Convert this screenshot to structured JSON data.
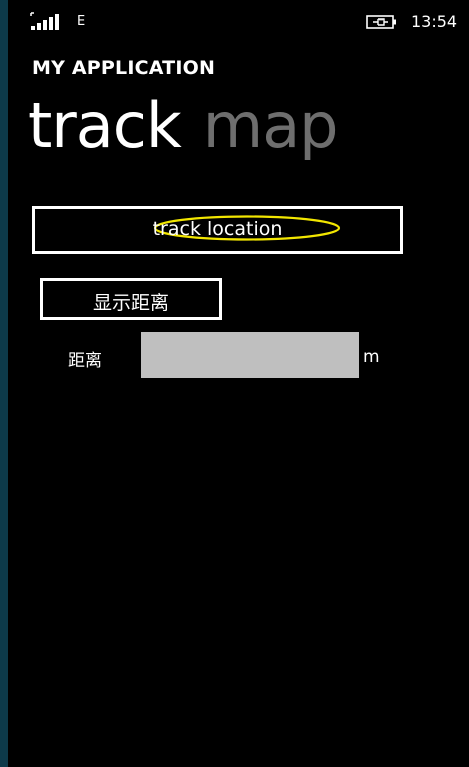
{
  "status_bar": {
    "signal_icon": "signal-strength-icon",
    "network": "E",
    "battery_icon": "battery-charging-icon",
    "time": "13:54"
  },
  "app": {
    "title": "MY APPLICATION"
  },
  "pivot": {
    "active": "track",
    "inactive": "map"
  },
  "track": {
    "button_label": "track location",
    "highlight_color": "#f2e600"
  },
  "distance": {
    "show_button_label": "显示距离",
    "label": "距离",
    "value": "",
    "unit": "m"
  }
}
